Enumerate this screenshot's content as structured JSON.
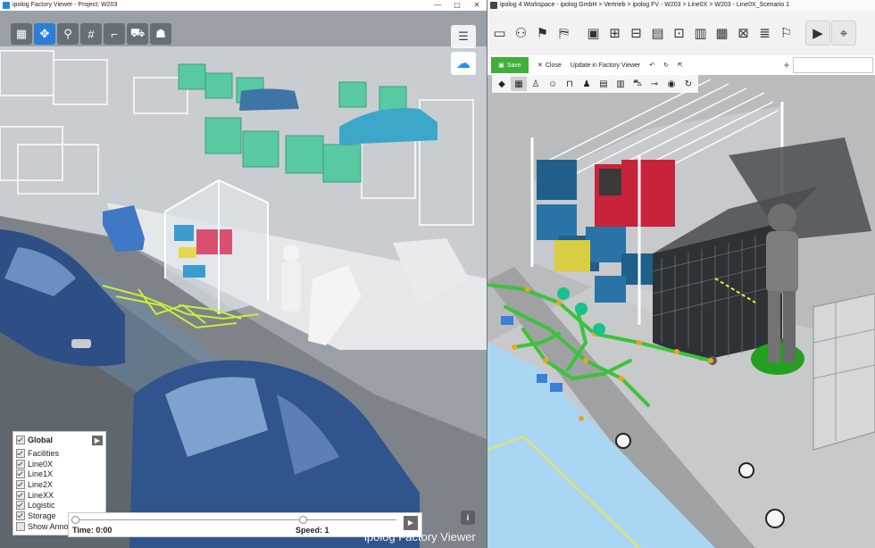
{
  "left": {
    "window_title": "ipolog Factory Viewer - Project: W203",
    "toolbar": [
      "layers-icon",
      "move-icon",
      "pin-icon",
      "grid-icon",
      "measure-icon",
      "forklift-icon",
      "person-icon"
    ],
    "layers_panel": {
      "header": "Global",
      "items": [
        {
          "label": "Facilities",
          "checked": true
        },
        {
          "label": "Line0X",
          "checked": true
        },
        {
          "label": "Line1X",
          "checked": true
        },
        {
          "label": "Line2X",
          "checked": true
        },
        {
          "label": "LineXX",
          "checked": true
        },
        {
          "label": "Logistic",
          "checked": true
        },
        {
          "label": "Storage",
          "checked": true
        },
        {
          "label": "Show Anno",
          "checked": false
        }
      ]
    },
    "playback": {
      "time_label": "Time: 0:00",
      "speed_label": "Speed: 1"
    },
    "info_label": "i",
    "watermark": "ipolog Factory Viewer"
  },
  "right": {
    "window_title": "ipolog 4 Workspace - ipolog GmbH > Vertrieb > ipolog FV - W203 > Line0X > W203 - Line0X_Scenario 1",
    "actions": {
      "save": "Save",
      "close": "Close",
      "update": "Update in Factory Viewer"
    },
    "colors": {
      "save": "#3fae3a",
      "path": "#3cc23c",
      "floor": "#a9d7f3"
    }
  }
}
